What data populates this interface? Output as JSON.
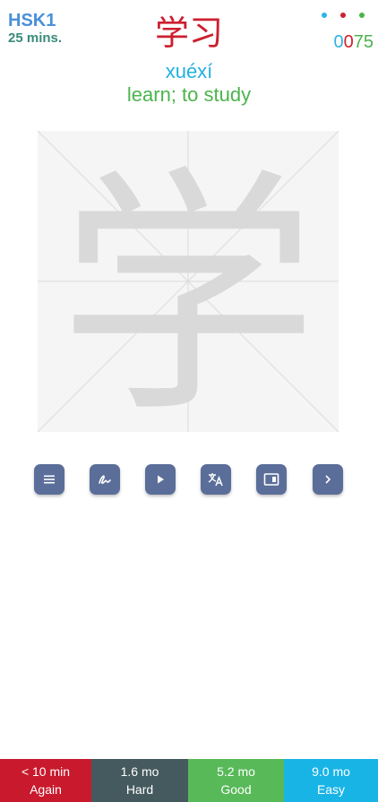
{
  "deck": {
    "name": "HSK1",
    "time": "25 mins."
  },
  "counts": {
    "dot_colors": [
      "#2bb3e6",
      "#d0202e",
      "#4bb34b"
    ],
    "new": "0",
    "learning": "0",
    "review": "75",
    "new_color": "#2bb3e6",
    "learning_color": "#d0202e",
    "review_color": "#4bb34b"
  },
  "card": {
    "hanzi": "学习",
    "hanzi_color": "#cc1f2f",
    "pinyin": "xuéxí",
    "pinyin_color": "#22b0e0",
    "meaning": "learn; to study",
    "meaning_color": "#4bb44b",
    "drawn_character": "学"
  },
  "toolbar": {
    "buttons": [
      {
        "name": "menu-button",
        "icon": "menu-icon"
      },
      {
        "name": "draw-button",
        "icon": "signature-icon"
      },
      {
        "name": "play-audio-button",
        "icon": "play-icon"
      },
      {
        "name": "translate-button",
        "icon": "translate-icon"
      },
      {
        "name": "card-info-button",
        "icon": "card-icon"
      },
      {
        "name": "next-button",
        "icon": "chevron-right-icon"
      }
    ]
  },
  "answers": [
    {
      "interval": "< 10 min",
      "label": "Again",
      "color": "#c8192d"
    },
    {
      "interval": "1.6 mo",
      "label": "Hard",
      "color": "#455a5e"
    },
    {
      "interval": "5.2 mo",
      "label": "Good",
      "color": "#58b958"
    },
    {
      "interval": "9.0 mo",
      "label": "Easy",
      "color": "#19b4e6"
    }
  ]
}
